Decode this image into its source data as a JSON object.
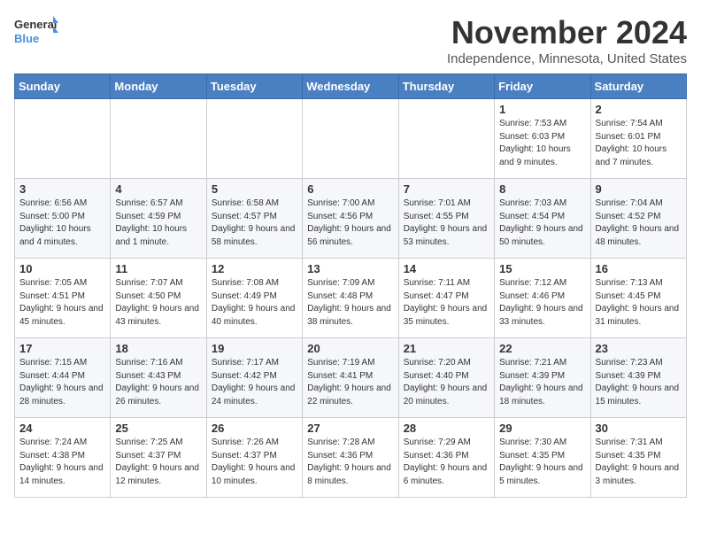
{
  "logo": {
    "line1": "General",
    "line2": "Blue"
  },
  "title": "November 2024",
  "location": "Independence, Minnesota, United States",
  "days_header": [
    "Sunday",
    "Monday",
    "Tuesday",
    "Wednesday",
    "Thursday",
    "Friday",
    "Saturday"
  ],
  "weeks": [
    [
      {
        "day": "",
        "info": ""
      },
      {
        "day": "",
        "info": ""
      },
      {
        "day": "",
        "info": ""
      },
      {
        "day": "",
        "info": ""
      },
      {
        "day": "",
        "info": ""
      },
      {
        "day": "1",
        "info": "Sunrise: 7:53 AM\nSunset: 6:03 PM\nDaylight: 10 hours and 9 minutes."
      },
      {
        "day": "2",
        "info": "Sunrise: 7:54 AM\nSunset: 6:01 PM\nDaylight: 10 hours and 7 minutes."
      }
    ],
    [
      {
        "day": "3",
        "info": "Sunrise: 6:56 AM\nSunset: 5:00 PM\nDaylight: 10 hours and 4 minutes."
      },
      {
        "day": "4",
        "info": "Sunrise: 6:57 AM\nSunset: 4:59 PM\nDaylight: 10 hours and 1 minute."
      },
      {
        "day": "5",
        "info": "Sunrise: 6:58 AM\nSunset: 4:57 PM\nDaylight: 9 hours and 58 minutes."
      },
      {
        "day": "6",
        "info": "Sunrise: 7:00 AM\nSunset: 4:56 PM\nDaylight: 9 hours and 56 minutes."
      },
      {
        "day": "7",
        "info": "Sunrise: 7:01 AM\nSunset: 4:55 PM\nDaylight: 9 hours and 53 minutes."
      },
      {
        "day": "8",
        "info": "Sunrise: 7:03 AM\nSunset: 4:54 PM\nDaylight: 9 hours and 50 minutes."
      },
      {
        "day": "9",
        "info": "Sunrise: 7:04 AM\nSunset: 4:52 PM\nDaylight: 9 hours and 48 minutes."
      }
    ],
    [
      {
        "day": "10",
        "info": "Sunrise: 7:05 AM\nSunset: 4:51 PM\nDaylight: 9 hours and 45 minutes."
      },
      {
        "day": "11",
        "info": "Sunrise: 7:07 AM\nSunset: 4:50 PM\nDaylight: 9 hours and 43 minutes."
      },
      {
        "day": "12",
        "info": "Sunrise: 7:08 AM\nSunset: 4:49 PM\nDaylight: 9 hours and 40 minutes."
      },
      {
        "day": "13",
        "info": "Sunrise: 7:09 AM\nSunset: 4:48 PM\nDaylight: 9 hours and 38 minutes."
      },
      {
        "day": "14",
        "info": "Sunrise: 7:11 AM\nSunset: 4:47 PM\nDaylight: 9 hours and 35 minutes."
      },
      {
        "day": "15",
        "info": "Sunrise: 7:12 AM\nSunset: 4:46 PM\nDaylight: 9 hours and 33 minutes."
      },
      {
        "day": "16",
        "info": "Sunrise: 7:13 AM\nSunset: 4:45 PM\nDaylight: 9 hours and 31 minutes."
      }
    ],
    [
      {
        "day": "17",
        "info": "Sunrise: 7:15 AM\nSunset: 4:44 PM\nDaylight: 9 hours and 28 minutes."
      },
      {
        "day": "18",
        "info": "Sunrise: 7:16 AM\nSunset: 4:43 PM\nDaylight: 9 hours and 26 minutes."
      },
      {
        "day": "19",
        "info": "Sunrise: 7:17 AM\nSunset: 4:42 PM\nDaylight: 9 hours and 24 minutes."
      },
      {
        "day": "20",
        "info": "Sunrise: 7:19 AM\nSunset: 4:41 PM\nDaylight: 9 hours and 22 minutes."
      },
      {
        "day": "21",
        "info": "Sunrise: 7:20 AM\nSunset: 4:40 PM\nDaylight: 9 hours and 20 minutes."
      },
      {
        "day": "22",
        "info": "Sunrise: 7:21 AM\nSunset: 4:39 PM\nDaylight: 9 hours and 18 minutes."
      },
      {
        "day": "23",
        "info": "Sunrise: 7:23 AM\nSunset: 4:39 PM\nDaylight: 9 hours and 15 minutes."
      }
    ],
    [
      {
        "day": "24",
        "info": "Sunrise: 7:24 AM\nSunset: 4:38 PM\nDaylight: 9 hours and 14 minutes."
      },
      {
        "day": "25",
        "info": "Sunrise: 7:25 AM\nSunset: 4:37 PM\nDaylight: 9 hours and 12 minutes."
      },
      {
        "day": "26",
        "info": "Sunrise: 7:26 AM\nSunset: 4:37 PM\nDaylight: 9 hours and 10 minutes."
      },
      {
        "day": "27",
        "info": "Sunrise: 7:28 AM\nSunset: 4:36 PM\nDaylight: 9 hours and 8 minutes."
      },
      {
        "day": "28",
        "info": "Sunrise: 7:29 AM\nSunset: 4:36 PM\nDaylight: 9 hours and 6 minutes."
      },
      {
        "day": "29",
        "info": "Sunrise: 7:30 AM\nSunset: 4:35 PM\nDaylight: 9 hours and 5 minutes."
      },
      {
        "day": "30",
        "info": "Sunrise: 7:31 AM\nSunset: 4:35 PM\nDaylight: 9 hours and 3 minutes."
      }
    ]
  ]
}
